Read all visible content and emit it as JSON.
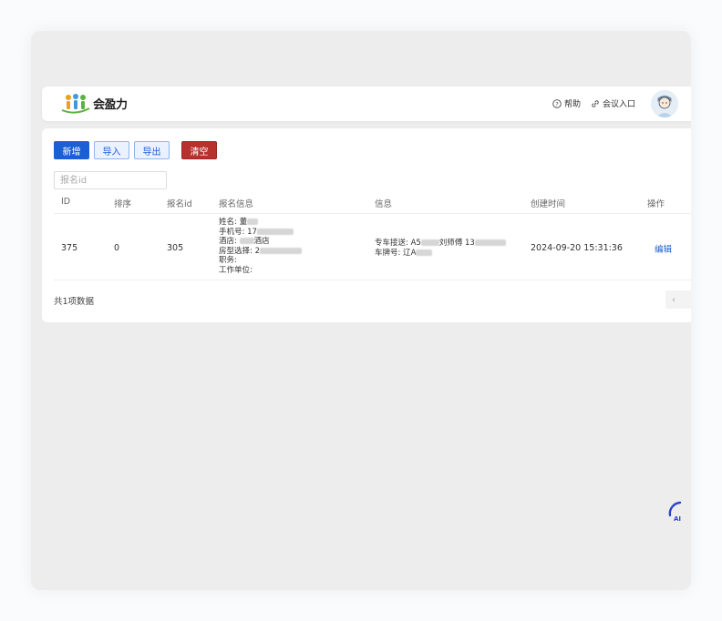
{
  "header": {
    "logo_text": "会盈力",
    "help_label": "帮助",
    "entry_label": "会议入口",
    "icons": {
      "help": "help-circle-icon",
      "entry": "link-icon"
    }
  },
  "toolbar": {
    "new_label": "新增",
    "import_label": "导入",
    "export_label": "导出",
    "clear_label": "清空"
  },
  "search": {
    "placeholder": "报名id",
    "value": ""
  },
  "table": {
    "columns": [
      "ID",
      "排序",
      "报名id",
      "报名信息",
      "信息",
      "创建时间",
      "操作"
    ],
    "rows": [
      {
        "id": "375",
        "order": "0",
        "signup_id": "305",
        "signup_info": {
          "name": "姓名: 董",
          "phone": "手机号: 17",
          "hotel_prefix": "酒店: ",
          "hotel_suffix": "酒店",
          "room": "房型选择: 2",
          "position": "职务:",
          "company": "工作单位:"
        },
        "info": {
          "pickup_prefix": "专车接送: A5",
          "pickup_driver": "刘师傅 13",
          "plate": "车牌号: 辽A"
        },
        "created": "2024-09-20 15:31:36",
        "action": "编辑"
      }
    ]
  },
  "footer": {
    "total": "共1项数据",
    "pager_prev": "‹"
  },
  "colors": {
    "primary": "#1a5fd3",
    "danger": "#b8322d",
    "background": "#ededee"
  }
}
